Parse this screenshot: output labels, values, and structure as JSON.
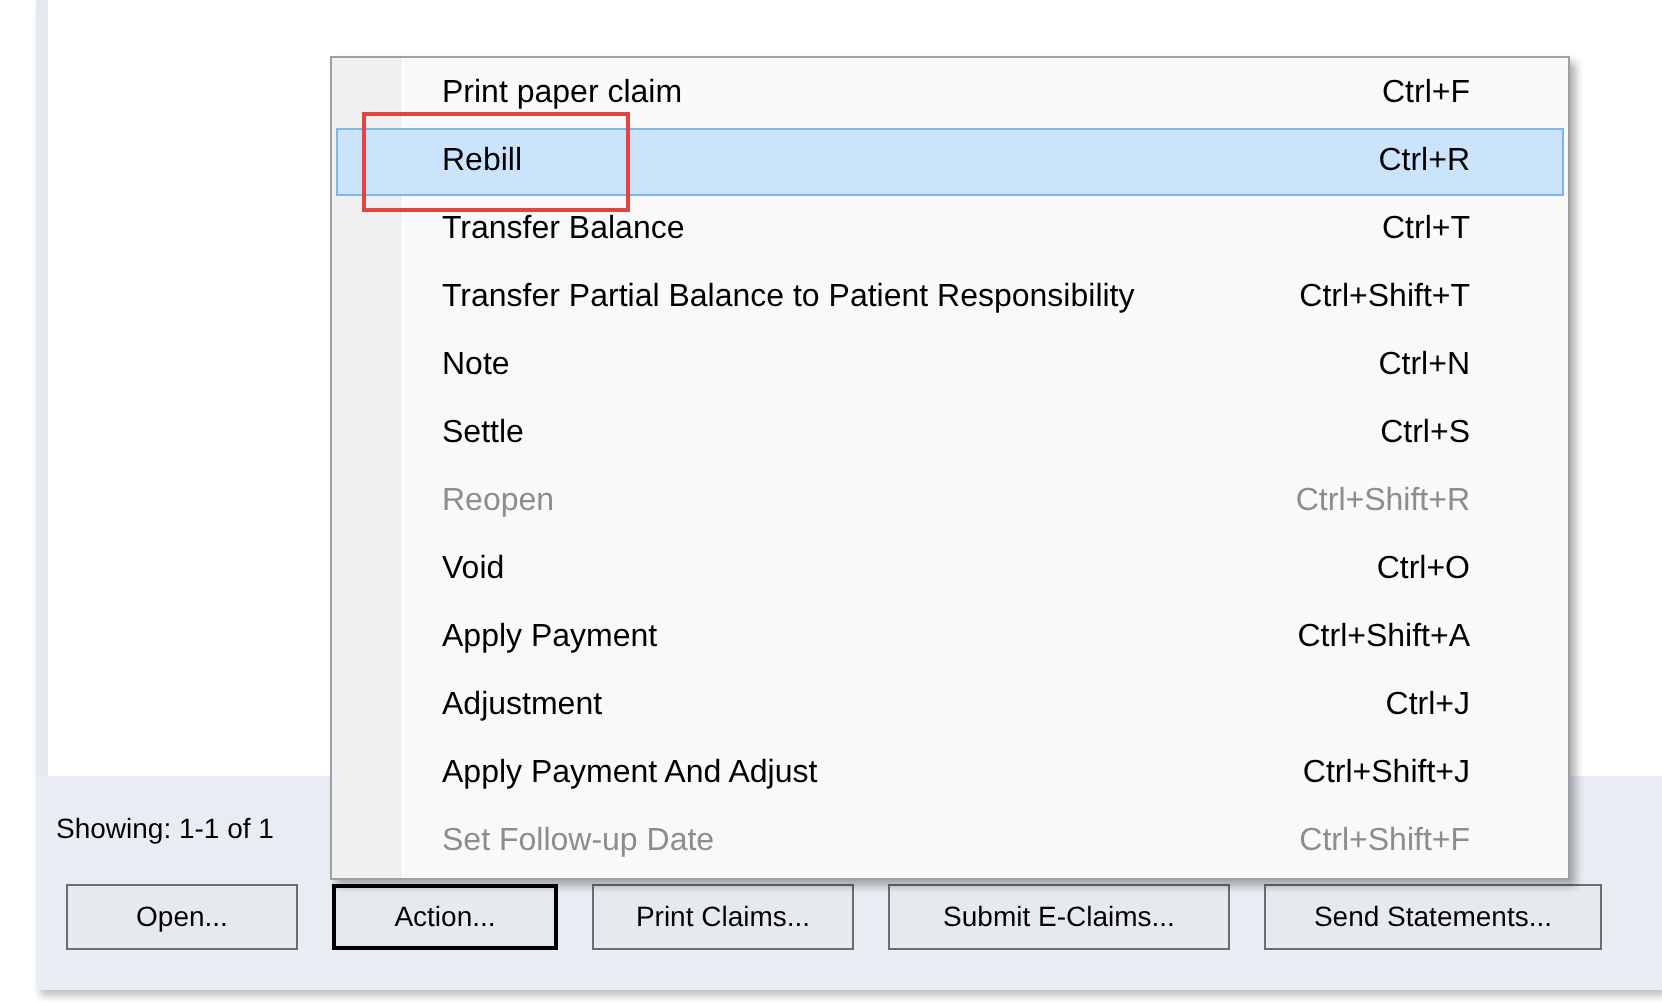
{
  "status_text": "Showing: 1-1 of 1",
  "menu": [
    {
      "label": "Print paper claim",
      "shortcut": "Ctrl+F",
      "selected": false,
      "disabled": false,
      "annotated": false
    },
    {
      "label": "Rebill",
      "shortcut": "Ctrl+R",
      "selected": true,
      "disabled": false,
      "annotated": true
    },
    {
      "label": "Transfer Balance",
      "shortcut": "Ctrl+T",
      "selected": false,
      "disabled": false,
      "annotated": false
    },
    {
      "label": "Transfer Partial Balance to Patient Responsibility",
      "shortcut": "Ctrl+Shift+T",
      "selected": false,
      "disabled": false,
      "annotated": false
    },
    {
      "label": "Note",
      "shortcut": "Ctrl+N",
      "selected": false,
      "disabled": false,
      "annotated": false
    },
    {
      "label": "Settle",
      "shortcut": "Ctrl+S",
      "selected": false,
      "disabled": false,
      "annotated": false
    },
    {
      "label": "Reopen",
      "shortcut": "Ctrl+Shift+R",
      "selected": false,
      "disabled": true,
      "annotated": false
    },
    {
      "label": "Void",
      "shortcut": "Ctrl+O",
      "selected": false,
      "disabled": false,
      "annotated": false
    },
    {
      "label": "Apply Payment",
      "shortcut": "Ctrl+Shift+A",
      "selected": false,
      "disabled": false,
      "annotated": false
    },
    {
      "label": "Adjustment",
      "shortcut": "Ctrl+J",
      "selected": false,
      "disabled": false,
      "annotated": false
    },
    {
      "label": "Apply Payment And Adjust",
      "shortcut": "Ctrl+Shift+J",
      "selected": false,
      "disabled": false,
      "annotated": false
    },
    {
      "label": "Set Follow-up Date",
      "shortcut": "Ctrl+Shift+F",
      "selected": false,
      "disabled": true,
      "annotated": false
    }
  ],
  "buttons": [
    {
      "label": "Open...",
      "focused": false
    },
    {
      "label": "Action...",
      "focused": true
    },
    {
      "label": "Print Claims...",
      "focused": false
    },
    {
      "label": "Submit E-Claims...",
      "focused": false
    },
    {
      "label": "Send Statements...",
      "focused": false
    }
  ]
}
